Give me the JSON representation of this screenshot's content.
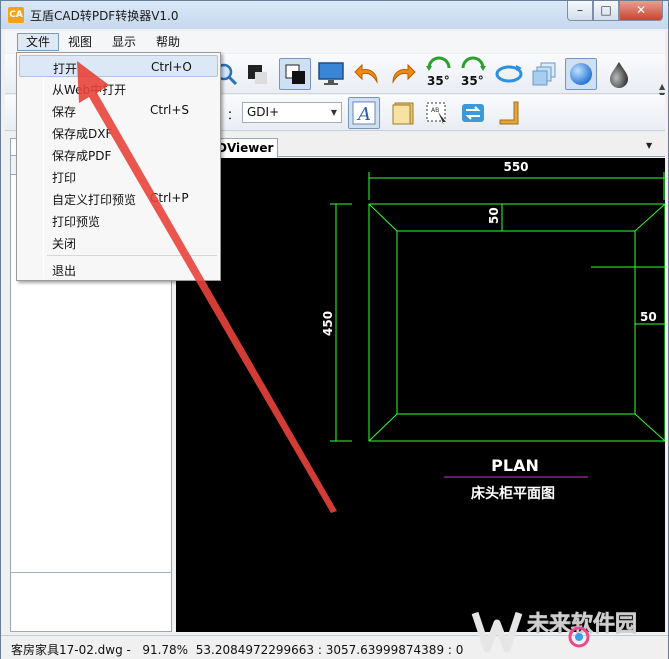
{
  "window": {
    "title": "互盾CAD转PDF转换器V1.0",
    "app_icon_text": "CA",
    "controls": {
      "minimize": "–",
      "maximize": "□",
      "close": "✕"
    }
  },
  "menubar": {
    "items": [
      {
        "label": "文件",
        "active": true
      },
      {
        "label": "视图"
      },
      {
        "label": "显示"
      },
      {
        "label": "帮助"
      }
    ]
  },
  "file_menu": {
    "items": [
      {
        "label": "打开",
        "shortcut": "Ctrl+O"
      },
      {
        "label": "从Web中打开",
        "shortcut": ""
      },
      {
        "label": "保存",
        "shortcut": "Ctrl+S"
      },
      {
        "label": "保存成DXF",
        "shortcut": ""
      },
      {
        "label": "保存成PDF",
        "shortcut": ""
      },
      {
        "label": "打印",
        "shortcut": ""
      },
      {
        "label": "自定义打印预览",
        "shortcut": "Ctrl+P"
      },
      {
        "label": "打印预览",
        "shortcut": ""
      },
      {
        "label": "关闭",
        "shortcut": ""
      },
      {
        "label": "退出",
        "shortcut": ""
      }
    ]
  },
  "toolbar": {
    "render_label": "：",
    "render_mode": "GDI+",
    "rotate_left_label": "35°",
    "rotate_right_label": "35°"
  },
  "document": {
    "tab_label": "DViewer"
  },
  "drawing": {
    "dim_top": "550",
    "dim_inner_top": "50",
    "dim_left": "450",
    "dim_right": "50",
    "title": "PLAN",
    "subtitle": "床头柜平面图",
    "colors": {
      "lines": "#33ff33",
      "text": "#ffffff",
      "underline": "#cc33cc"
    }
  },
  "statusbar": {
    "file": "客房家具17-02.dwg",
    "zoom": "91.78%",
    "coords": "53.2084972299663 : 3057.63999874389 : 0"
  },
  "watermark": {
    "text": "未来软件园"
  }
}
